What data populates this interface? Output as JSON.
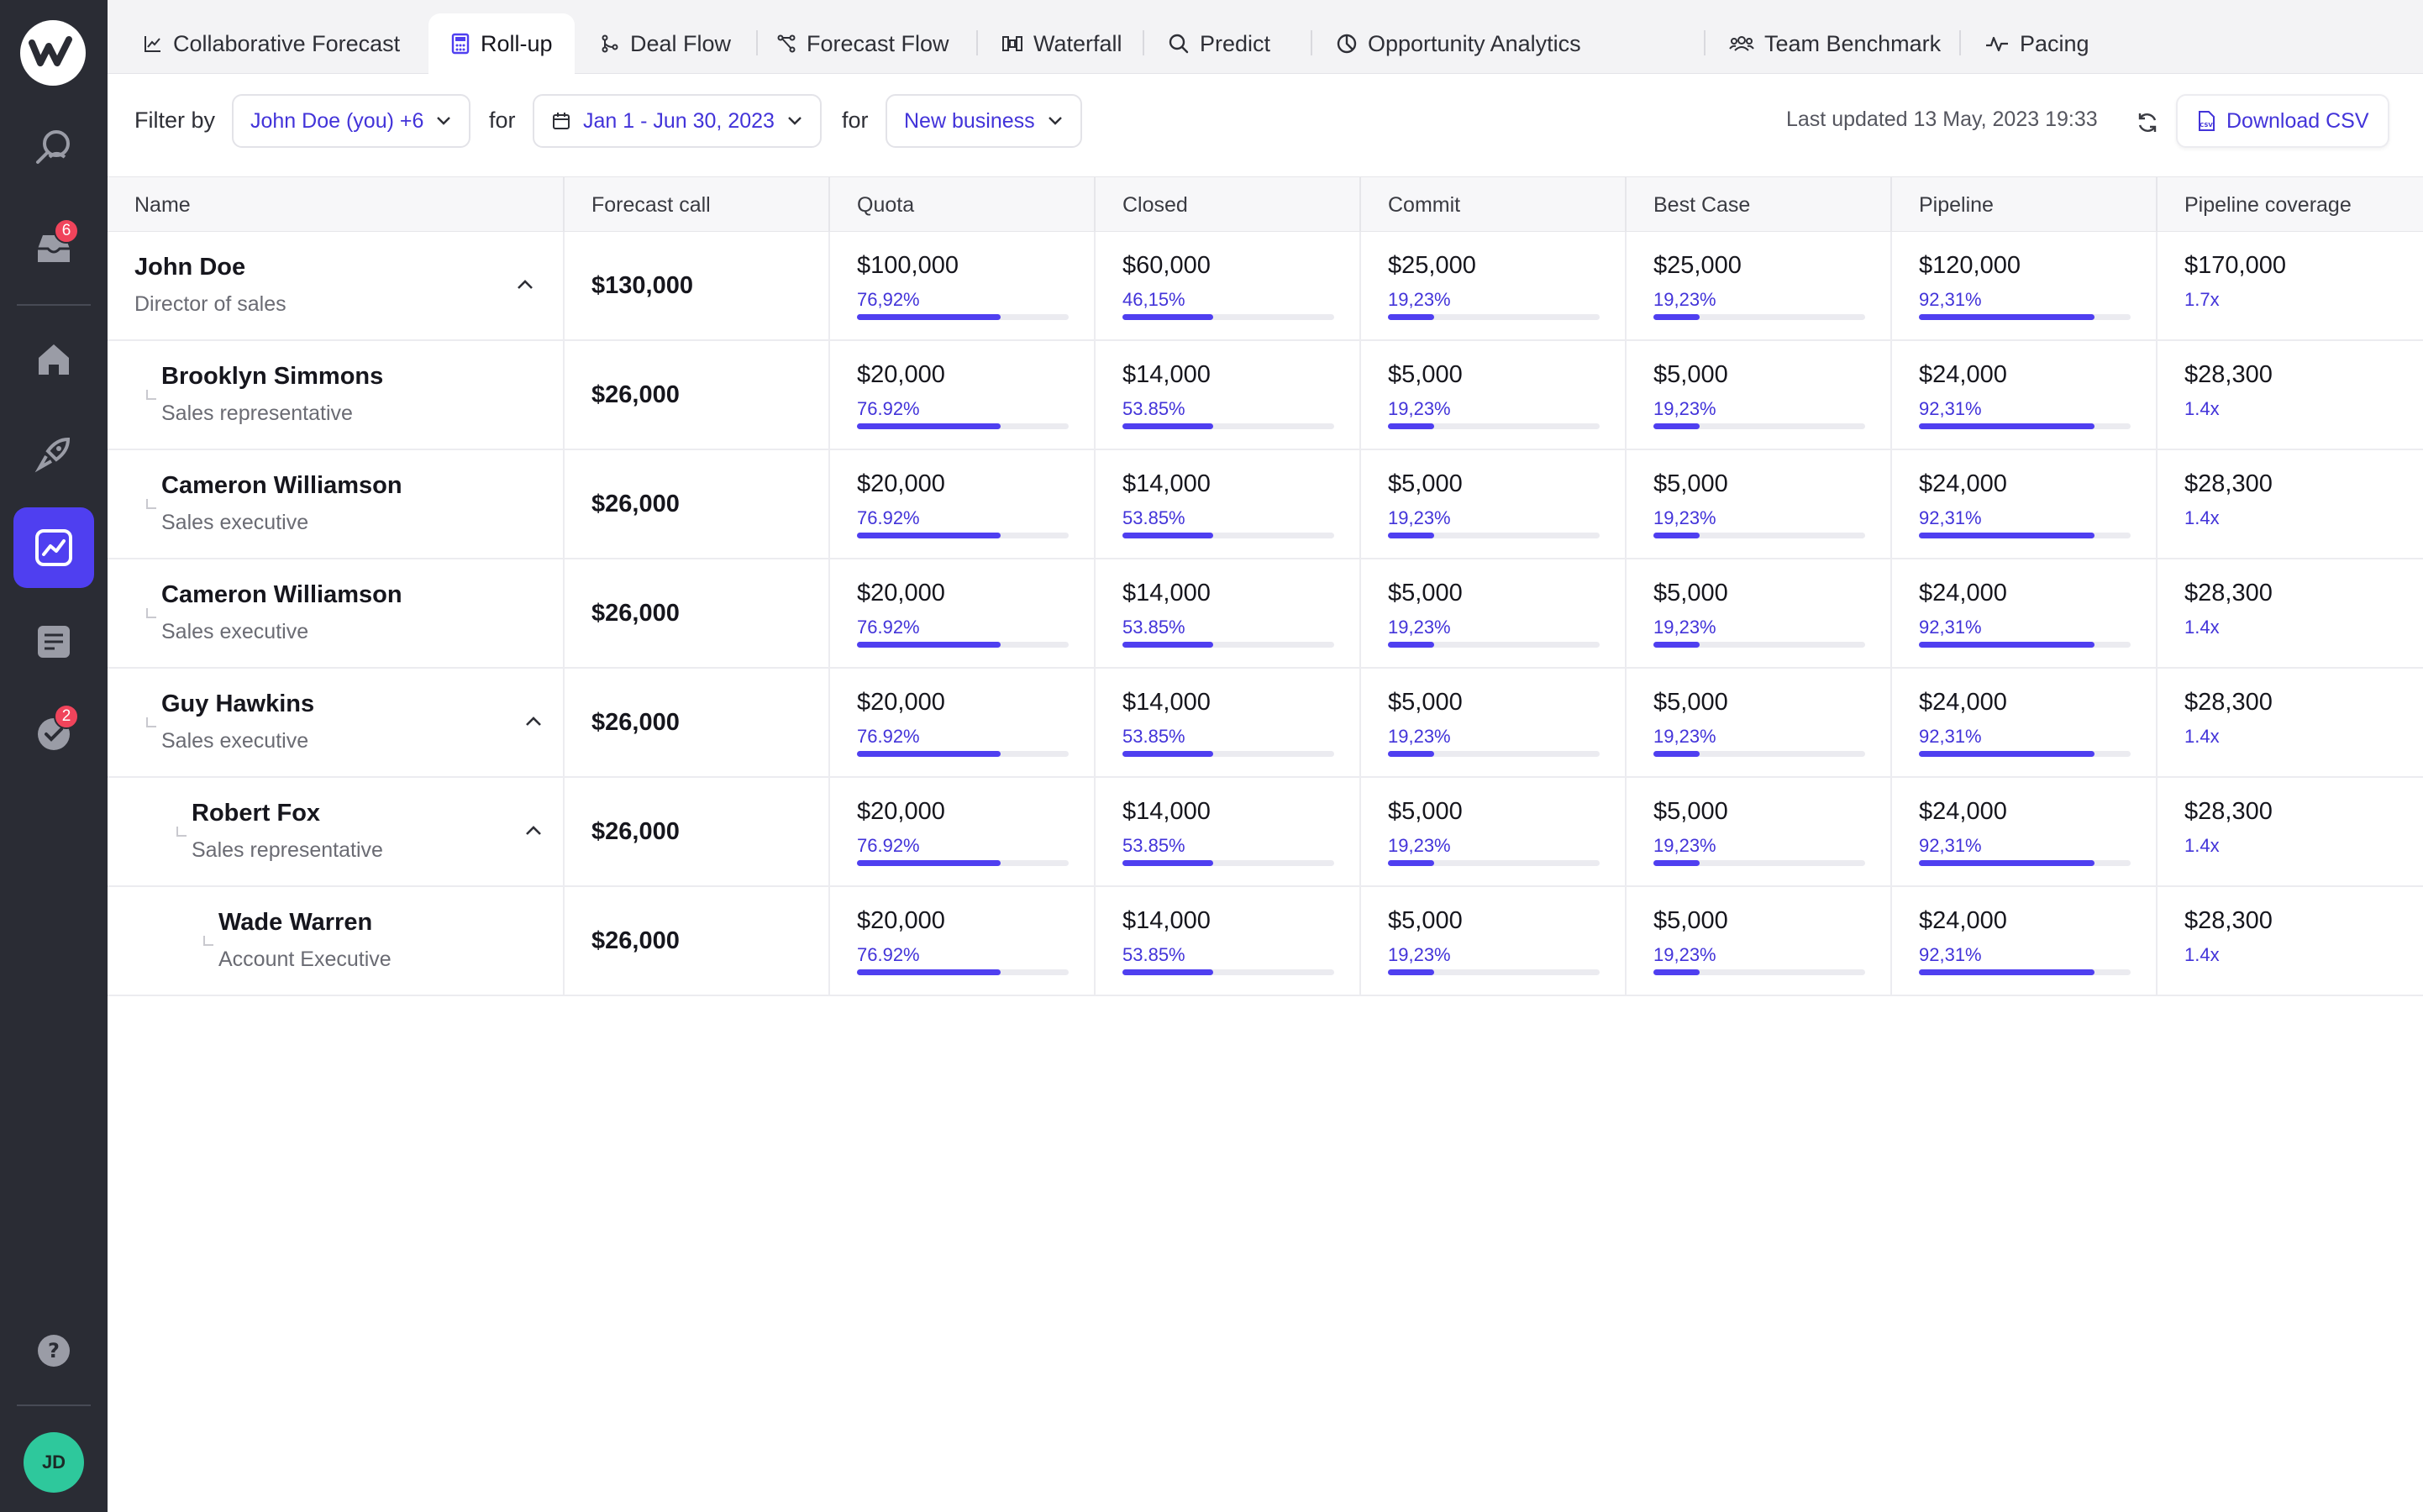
{
  "sidebar": {
    "inbox_badge": "6",
    "tasks_badge": "2",
    "avatar_initials": "JD",
    "icons": [
      "logo-icon",
      "search-people-icon",
      "inbox-icon",
      "home-icon",
      "rocket-icon",
      "chart-icon",
      "notes-icon",
      "check-circle-icon",
      "help-icon"
    ]
  },
  "tabs": [
    {
      "label": "Collaborative Forecast",
      "icon": "line-chart-icon"
    },
    {
      "label": "Roll-up",
      "icon": "calculator-icon",
      "active": true
    },
    {
      "label": "Deal Flow",
      "icon": "flow-icon"
    },
    {
      "label": "Forecast Flow",
      "icon": "branch-icon"
    },
    {
      "label": "Waterfall",
      "icon": "waterfall-icon"
    },
    {
      "label": "Predict",
      "icon": "search-icon"
    },
    {
      "label": "Opportunity Analytics",
      "icon": "pie-icon"
    },
    {
      "label": "Team Benchmark",
      "icon": "team-icon"
    },
    {
      "label": "Pacing",
      "icon": "pulse-icon"
    }
  ],
  "filter": {
    "filter_by_label": "Filter by",
    "user_value": "John Doe (you) +6",
    "for_label_1": "for",
    "date_value": "Jan 1 - Jun 30, 2023",
    "for_label_2": "for",
    "type_value": "New business",
    "last_updated": "Last updated 13 May, 2023 19:33",
    "download_label": "Download CSV"
  },
  "colors": {
    "accent": "#4f3ff0",
    "accent_text": "#4233d9",
    "sidebar_bg": "#2a2c34",
    "badge": "#f0445b",
    "avatar": "#2ec89c"
  },
  "table": {
    "headers": [
      "Name",
      "Forecast call",
      "Quota",
      "Closed",
      "Commit",
      "Best Case",
      "Pipeline",
      "Pipeline coverage"
    ],
    "rows": [
      {
        "name": "John Doe",
        "role": "Director of sales",
        "depth": 0,
        "expand": true,
        "forecast": "$130,000",
        "quota": {
          "value": "$100,000",
          "pct": "76,92%",
          "fill": 0.68
        },
        "closed": {
          "value": "$60,000",
          "pct": "46,15%",
          "fill": 0.43
        },
        "commit": {
          "value": "$25,000",
          "pct": "19,23%",
          "fill": 0.22
        },
        "best_case": {
          "value": "$25,000",
          "pct": "19,23%",
          "fill": 0.22
        },
        "pipeline": {
          "value": "$120,000",
          "pct": "92,31%",
          "fill": 0.83
        },
        "coverage": {
          "value": "$170,000",
          "ratio": "1.7x"
        }
      },
      {
        "name": "Brooklyn Simmons",
        "role": "Sales representative",
        "depth": 1,
        "expand": false,
        "forecast": "$26,000",
        "quota": {
          "value": "$20,000",
          "pct": "76.92%",
          "fill": 0.68
        },
        "closed": {
          "value": "$14,000",
          "pct": "53.85%",
          "fill": 0.43
        },
        "commit": {
          "value": "$5,000",
          "pct": "19,23%",
          "fill": 0.22
        },
        "best_case": {
          "value": "$5,000",
          "pct": "19,23%",
          "fill": 0.22
        },
        "pipeline": {
          "value": "$24,000",
          "pct": "92,31%",
          "fill": 0.83
        },
        "coverage": {
          "value": "$28,300",
          "ratio": "1.4x"
        }
      },
      {
        "name": "Cameron Williamson",
        "role": "Sales executive",
        "depth": 1,
        "expand": false,
        "forecast": "$26,000",
        "quota": {
          "value": "$20,000",
          "pct": "76.92%",
          "fill": 0.68
        },
        "closed": {
          "value": "$14,000",
          "pct": "53.85%",
          "fill": 0.43
        },
        "commit": {
          "value": "$5,000",
          "pct": "19,23%",
          "fill": 0.22
        },
        "best_case": {
          "value": "$5,000",
          "pct": "19,23%",
          "fill": 0.22
        },
        "pipeline": {
          "value": "$24,000",
          "pct": "92,31%",
          "fill": 0.83
        },
        "coverage": {
          "value": "$28,300",
          "ratio": "1.4x"
        }
      },
      {
        "name": "Cameron Williamson",
        "role": "Sales executive",
        "depth": 1,
        "expand": false,
        "forecast": "$26,000",
        "quota": {
          "value": "$20,000",
          "pct": "76.92%",
          "fill": 0.68
        },
        "closed": {
          "value": "$14,000",
          "pct": "53.85%",
          "fill": 0.43
        },
        "commit": {
          "value": "$5,000",
          "pct": "19,23%",
          "fill": 0.22
        },
        "best_case": {
          "value": "$5,000",
          "pct": "19,23%",
          "fill": 0.22
        },
        "pipeline": {
          "value": "$24,000",
          "pct": "92,31%",
          "fill": 0.83
        },
        "coverage": {
          "value": "$28,300",
          "ratio": "1.4x"
        }
      },
      {
        "name": "Guy Hawkins",
        "role": "Sales executive",
        "depth": 1,
        "expand": true,
        "forecast": "$26,000",
        "quota": {
          "value": "$20,000",
          "pct": "76.92%",
          "fill": 0.68
        },
        "closed": {
          "value": "$14,000",
          "pct": "53.85%",
          "fill": 0.43
        },
        "commit": {
          "value": "$5,000",
          "pct": "19,23%",
          "fill": 0.22
        },
        "best_case": {
          "value": "$5,000",
          "pct": "19,23%",
          "fill": 0.22
        },
        "pipeline": {
          "value": "$24,000",
          "pct": "92,31%",
          "fill": 0.83
        },
        "coverage": {
          "value": "$28,300",
          "ratio": "1.4x"
        }
      },
      {
        "name": "Robert Fox",
        "role": "Sales representative",
        "depth": 2,
        "expand": true,
        "forecast": "$26,000",
        "quota": {
          "value": "$20,000",
          "pct": "76.92%",
          "fill": 0.68
        },
        "closed": {
          "value": "$14,000",
          "pct": "53.85%",
          "fill": 0.43
        },
        "commit": {
          "value": "$5,000",
          "pct": "19,23%",
          "fill": 0.22
        },
        "best_case": {
          "value": "$5,000",
          "pct": "19,23%",
          "fill": 0.22
        },
        "pipeline": {
          "value": "$24,000",
          "pct": "92,31%",
          "fill": 0.83
        },
        "coverage": {
          "value": "$28,300",
          "ratio": "1.4x"
        }
      },
      {
        "name": "Wade Warren",
        "role": "Account Executive",
        "depth": 3,
        "expand": false,
        "forecast": "$26,000",
        "quota": {
          "value": "$20,000",
          "pct": "76.92%",
          "fill": 0.68
        },
        "closed": {
          "value": "$14,000",
          "pct": "53.85%",
          "fill": 0.43
        },
        "commit": {
          "value": "$5,000",
          "pct": "19,23%",
          "fill": 0.22
        },
        "best_case": {
          "value": "$5,000",
          "pct": "19,23%",
          "fill": 0.22
        },
        "pipeline": {
          "value": "$24,000",
          "pct": "92,31%",
          "fill": 0.83
        },
        "coverage": {
          "value": "$28,300",
          "ratio": "1.4x"
        }
      }
    ]
  }
}
